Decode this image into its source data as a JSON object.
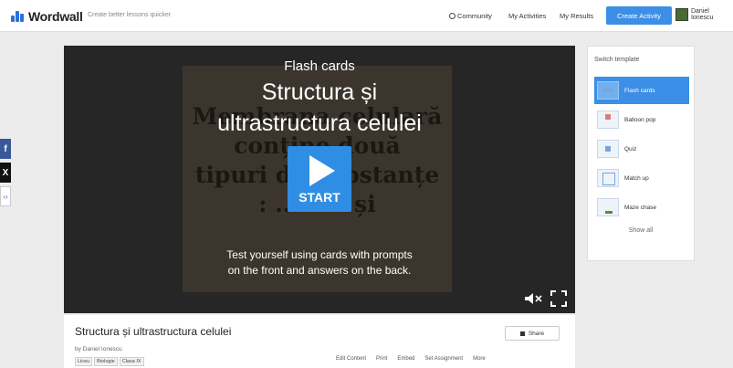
{
  "header": {
    "logo_text": "Wordwall",
    "tagline": "Create better lessons quicker",
    "nav_community": "Community",
    "nav_activities": "My Activities",
    "nav_results": "My Results",
    "create_label": "Create Activity",
    "user_name": "Daniel Ionescu"
  },
  "social": {
    "facebook": "f",
    "x": "X",
    "share": "‹›"
  },
  "player": {
    "template_name": "Flash cards",
    "title_line1": "Structura și",
    "title_line2": "ultrastructura celulei",
    "card_line1": "Membrana celulară",
    "card_line2": "conține două",
    "card_line3": "tipuri de substanțe",
    "card_line4": ": ......... și",
    "start_label": "START",
    "desc_line1": "Test yourself using cards with prompts",
    "desc_line2": "on the front and answers on the back."
  },
  "switch_panel": {
    "title": "Switch template",
    "items": [
      {
        "label": "Flash cards",
        "active": true
      },
      {
        "label": "Balloon pop",
        "active": false
      },
      {
        "label": "Quiz",
        "active": false
      },
      {
        "label": "Match up",
        "active": false
      },
      {
        "label": "Maze chase",
        "active": false
      }
    ],
    "more": "Show all"
  },
  "info": {
    "title": "Structura și ultrastructura celulei",
    "share_label": "Share",
    "author": "by Daniel Ionescu",
    "tags": [
      "Liceu",
      "Biologie",
      "Clasa IX"
    ],
    "actions": [
      "Edit Content",
      "Print",
      "Embed",
      "Set Assignment",
      "More"
    ]
  },
  "colors": {
    "accent": "#3c8ee6",
    "player_bg": "#262626",
    "card_bg": "#3b352d"
  }
}
